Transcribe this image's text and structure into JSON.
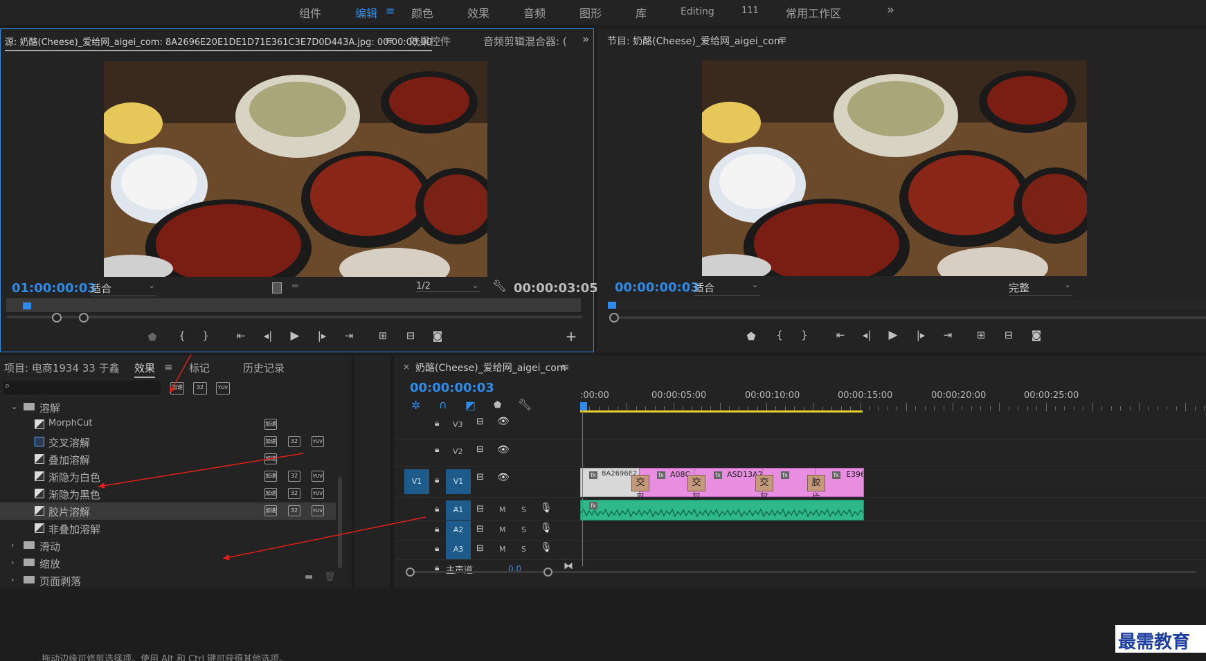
{
  "topbar": {
    "workspaces": [
      "组件",
      "编辑",
      "颜色",
      "效果",
      "音频",
      "图形",
      "库",
      "Editing",
      "111",
      "常用工作区"
    ],
    "active": "编辑",
    "overflow_icon": "»"
  },
  "source_panel": {
    "tab_title": "源: 奶酪(Cheese)_爱给网_aigei_com: 8A2696E20E1DE1D71E361C3E7D0D443A.jpg: 00:00:00:00",
    "menu_icon": "≡",
    "other_tabs": [
      "效果控件",
      "音频剪辑混合器: ("
    ],
    "overflow_icon": "»",
    "timecode": "01:00:00:03",
    "fit_label": "适合",
    "resolution": "1/2",
    "duration": "00:00:03:05"
  },
  "program_panel": {
    "tab_title": "节目: 奶酪(Cheese)_爱给网_aigei_com",
    "menu_icon": "≡",
    "timecode": "00:00:00:03",
    "fit_label": "适合",
    "quality": "完整"
  },
  "effects_panel": {
    "tabs": [
      "项目: 电商1934 33 于鑫",
      "效果",
      "标记",
      "历史记录"
    ],
    "active_tab": "效果",
    "menu_icon": "≡",
    "search_placeholder": "",
    "filter_badges": [
      "加速",
      "32",
      "YUV"
    ],
    "tree": [
      {
        "label": "溶解",
        "type": "folder",
        "expanded": true
      },
      {
        "label": "MorphCut",
        "type": "item",
        "badges": [
          "加速"
        ]
      },
      {
        "label": "交叉溶解",
        "type": "item",
        "badges": [
          "加速",
          "32",
          "YUV"
        ],
        "highlighted": true
      },
      {
        "label": "叠加溶解",
        "type": "item",
        "badges": [
          "加速"
        ]
      },
      {
        "label": "渐隐为白色",
        "type": "item",
        "badges": [
          "加速",
          "32",
          "YUV"
        ]
      },
      {
        "label": "渐隐为黑色",
        "type": "item",
        "badges": [
          "加速",
          "32",
          "YUV"
        ]
      },
      {
        "label": "胶片溶解",
        "type": "item",
        "badges": [
          "加速",
          "32",
          "YUV"
        ],
        "selected": true
      },
      {
        "label": "非叠加溶解",
        "type": "item",
        "badges": []
      },
      {
        "label": "滑动",
        "type": "folder",
        "expanded": false
      },
      {
        "label": "缩放",
        "type": "folder",
        "expanded": false
      },
      {
        "label": "页面剥落",
        "type": "folder",
        "expanded": false
      }
    ]
  },
  "timeline": {
    "tab_title": "奶酪(Cheese)_爱给网_aigei_com",
    "close_icon": "×",
    "menu_icon": "≡",
    "timecode": "00:00:00:03",
    "ruler_labels": [
      ":00:00",
      "00:00:05:00",
      "00:00:10:00",
      "00:00:15:00",
      "00:00:20:00",
      "00:00:25:00"
    ],
    "video_tracks": [
      "V3",
      "V2",
      "V1"
    ],
    "source_patch": "V1",
    "audio_tracks": [
      "A1",
      "A2",
      "A3"
    ],
    "master_label": "主声道",
    "master_value": "0.0",
    "track_buttons": {
      "mute": "M",
      "solo": "S"
    },
    "clips": [
      {
        "name": "8A2696E2",
        "fx": "fx"
      },
      {
        "name": "A08C",
        "fx": "fx"
      },
      {
        "name": "ASD13A2",
        "fx": "fx"
      },
      {
        "name": "",
        "fx": "fx"
      },
      {
        "name": "E396",
        "fx": "fx"
      }
    ],
    "transitions": [
      "交叉",
      "交叉",
      "交叉",
      "胶片"
    ]
  },
  "statusbar": {
    "text": "拖动边缘可修剪选择项。使用 Alt 和 Ctrl 键可获得其他选项。"
  },
  "watermark": "最需教育",
  "colors": {
    "accent": "#2d8ceb",
    "clip": "#e88ee0",
    "audio": "#2fb98a",
    "playhead": "#2d8ceb"
  }
}
